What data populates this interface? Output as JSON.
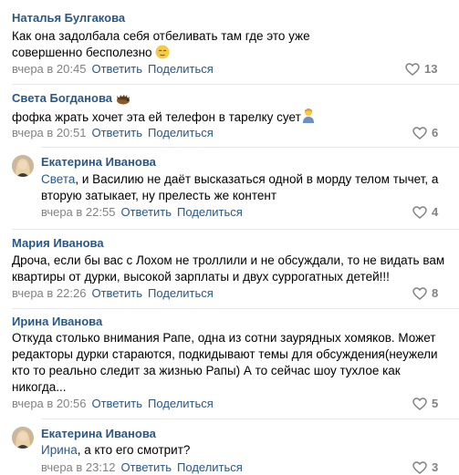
{
  "actions": {
    "reply": "Ответить",
    "share": "Поделиться"
  },
  "comments": [
    {
      "author": "Наталья Булгакова",
      "text": "Как она задолбала себя отбеливать там где это уже совершенно бесполезно",
      "date": "вчера в 20:45",
      "likes": "13"
    },
    {
      "author": "Света Богданова",
      "text": "фофка жрать хочет эта ей телефон в тарелку сует",
      "date": "вчера в 20:51",
      "likes": "6"
    },
    {
      "author": "Екатерина Иванова",
      "mention": "Света",
      "text": ", и Василию не даёт высказаться одной в морду телом тычет, а вторую затыкает, ну прелесть же контент",
      "date": "вчера в 22:55",
      "likes": "4"
    },
    {
      "author": "Мария Иванова",
      "text": "Дроча, если бы вас с Лохом не троллили и не обсуждали, то не видать вам квартиры от дурки, высокой зарплаты и двух суррогатных детей!!!",
      "date": "вчера в 22:26",
      "likes": "8"
    },
    {
      "author": "Ирина Иванова",
      "text": "Откуда столько внимания Рапе, одна из сотни заурядных хомяков. Может редакторы дурки стараются, подкидывают темы для обсуждения(неужели кто то реально следит за жизнью Рапы) А то сейчас шоу тухлое как никогда...",
      "date": "вчера в 20:56",
      "likes": "5"
    },
    {
      "author": "Екатерина Иванова",
      "mention": "Ирина",
      "text": ", а кто его смотрит?",
      "date": "вчера в 23:12",
      "likes": "3"
    }
  ]
}
